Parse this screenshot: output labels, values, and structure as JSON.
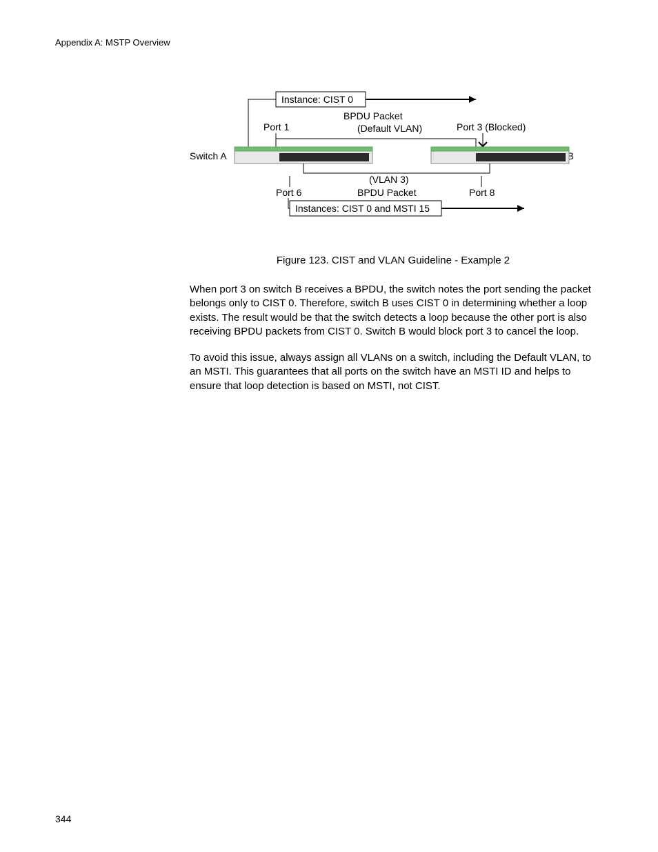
{
  "header": "Appendix A: MSTP Overview",
  "page_number": "344",
  "caption": "Figure 123. CIST and VLAN Guideline - Example 2",
  "para1": "When port 3 on switch B receives a BPDU, the switch notes the port sending the packet belongs only to CIST 0. Therefore, switch B uses CIST 0 in determining whether a loop exists. The result would be that the switch detects a loop because the other port is also receiving BPDU packets from CIST 0. Switch B would block port 3 to cancel the loop.",
  "para2": "To avoid this issue, always assign all VLANs on a switch, including the Default VLAN, to an MSTI. This guarantees that all ports on the switch have an MSTI ID and helps to ensure that loop detection is based on MSTI, not CIST.",
  "diagram": {
    "instance_top": "Instance: CIST 0",
    "bpdu_top": "BPDU Packet",
    "default_vlan": "(Default VLAN)",
    "port1": "Port 1",
    "port3": "Port 3 (Blocked)",
    "switch_a": "Switch A",
    "switch_b": "Switch B",
    "vlan3": "(VLAN 3)",
    "port6": "Port 6",
    "bpdu_bottom": "BPDU Packet",
    "port8": "Port 8",
    "instance_bottom": "Instances: CIST 0 and MSTI 15"
  }
}
